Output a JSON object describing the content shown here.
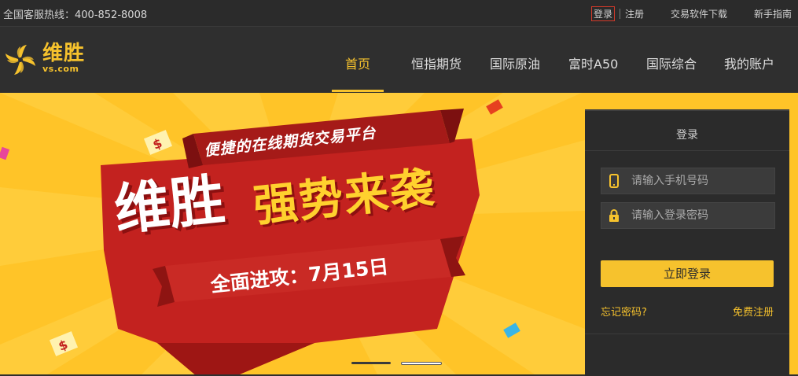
{
  "topbar": {
    "hotline_label": "全国客服热线：",
    "hotline_number": "400-852-8008",
    "login": "登录",
    "register": "注册",
    "download": "交易软件下载",
    "guide": "新手指南"
  },
  "logo": {
    "cn": "维胜",
    "en": "vs.com"
  },
  "nav": {
    "items": [
      {
        "label": "首页"
      },
      {
        "label": "恒指期货"
      },
      {
        "label": "国际原油"
      },
      {
        "label": "富时A50"
      },
      {
        "label": "国际综合"
      },
      {
        "label": "我的账户"
      }
    ]
  },
  "banner": {
    "subtitle": "便捷的在线期货交易平台",
    "title_white": "维胜",
    "title_yellow": "强势来袭",
    "date_line": "全面进攻：7月15日"
  },
  "login_panel": {
    "title": "登录",
    "phone_placeholder": "请输入手机号码",
    "password_placeholder": "请输入登录密码",
    "submit": "立即登录",
    "forgot": "忘记密码?",
    "free_register": "免费注册"
  },
  "colors": {
    "accent": "#f6c22d",
    "banner_bg": "#ffc428",
    "ribbon_red": "#b8201d",
    "dark_bg": "#2f2f2f"
  }
}
